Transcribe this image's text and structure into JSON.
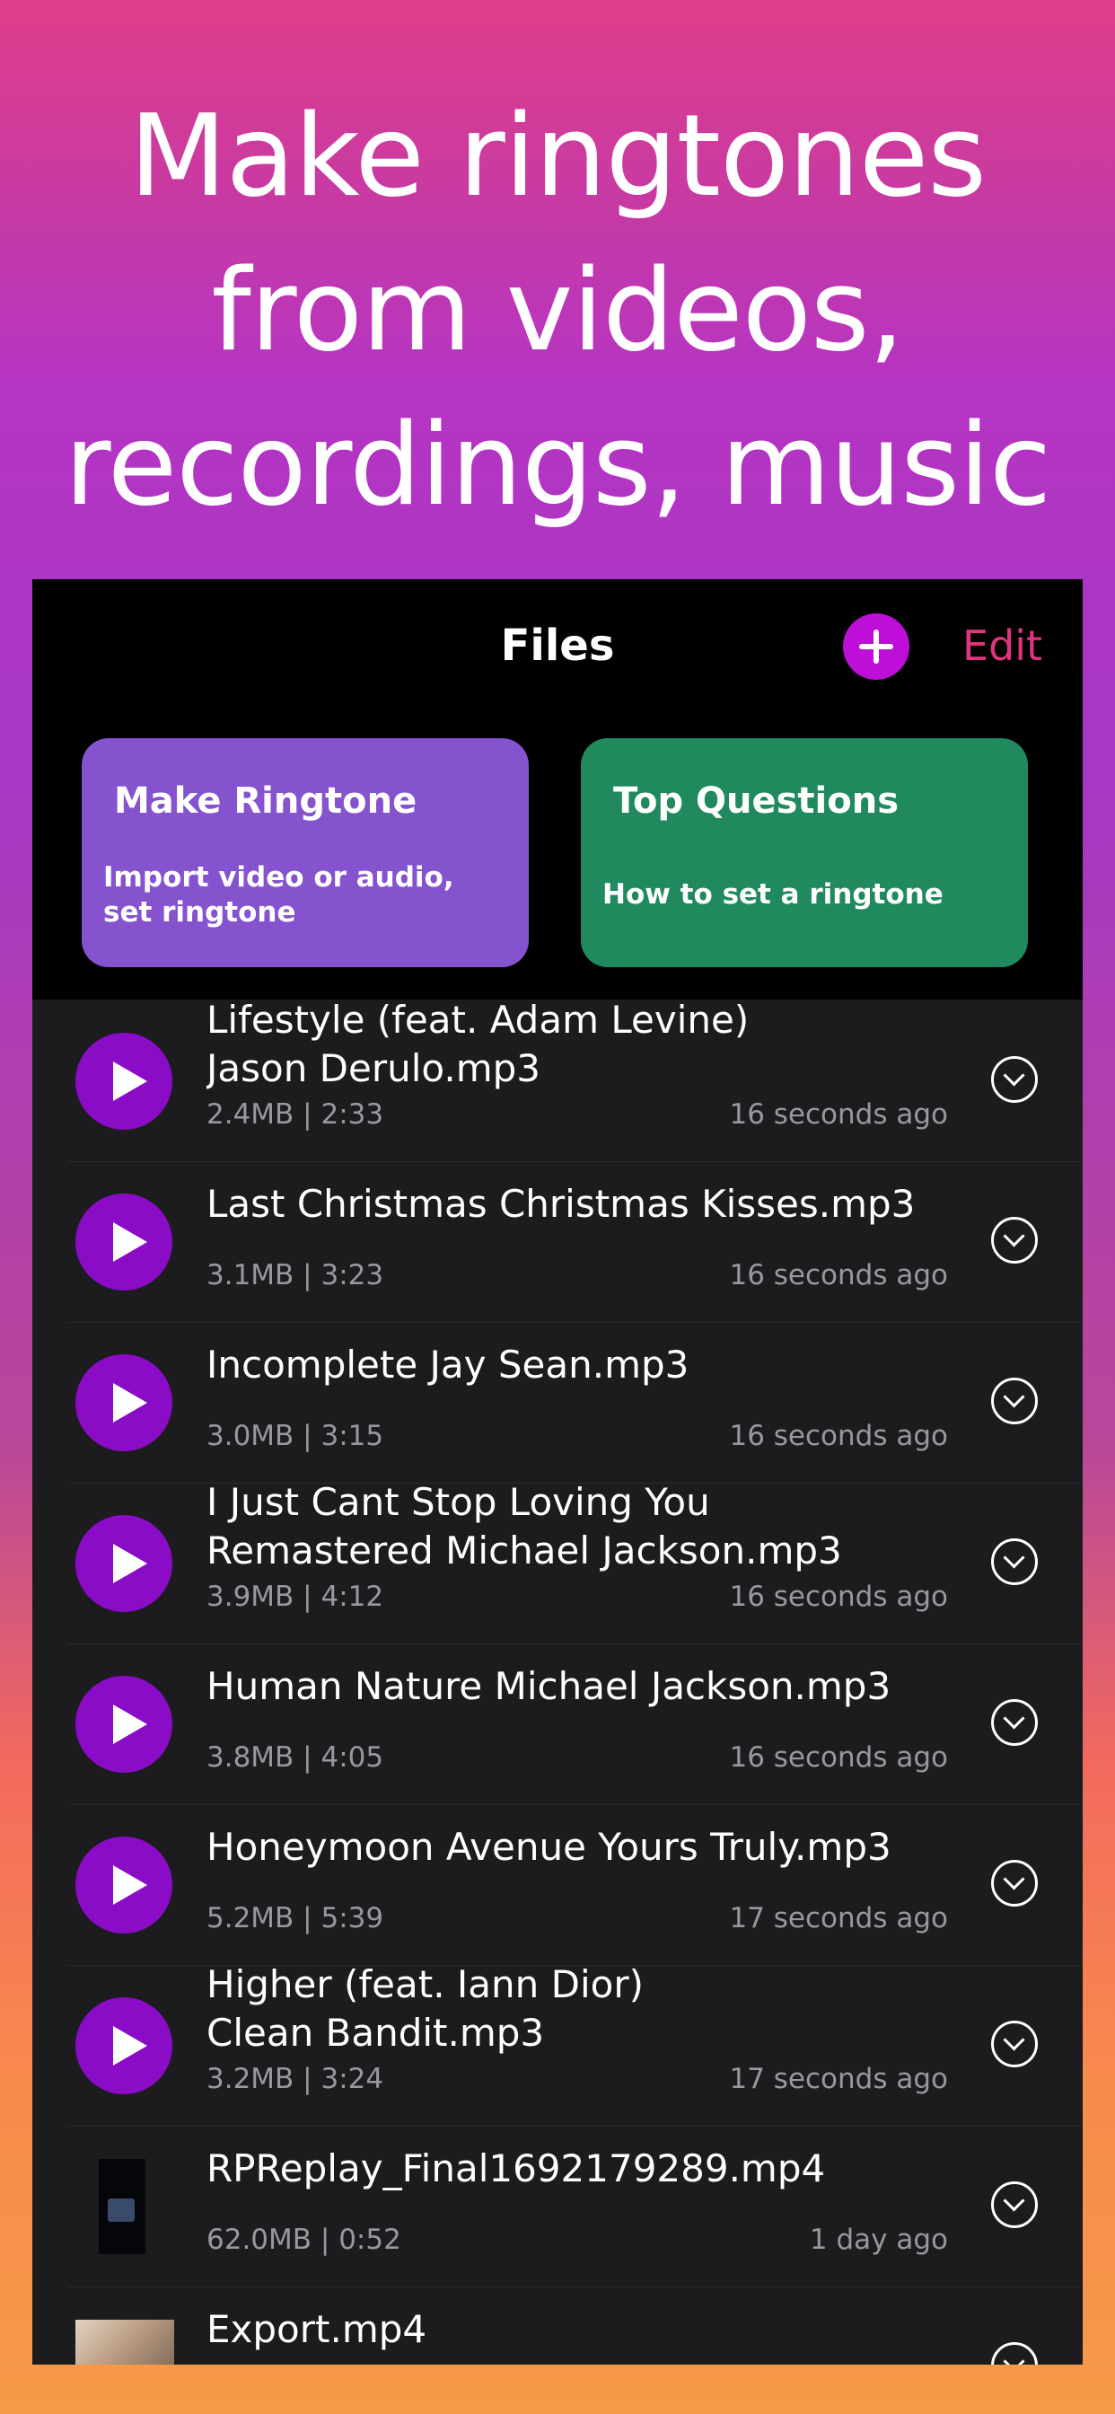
{
  "headline": {
    "line1": "Make ringtones",
    "line2": "from videos,",
    "line3": "recordings, music"
  },
  "header": {
    "title": "Files",
    "add_icon": "plus-circle-icon",
    "edit_label": "Edit"
  },
  "cards": {
    "make": {
      "title": "Make Ringtone",
      "subtitle": "Import video or audio, set ringtone"
    },
    "faq": {
      "title": "Top Questions",
      "subtitle": "How to set a ringtone"
    }
  },
  "files": [
    {
      "line1": "Lifestyle (feat. Adam Levine)",
      "line2": "Jason Derulo.mp3",
      "meta": "2.4MB | 2:33",
      "time": "16 seconds ago",
      "icon": "play-icon"
    },
    {
      "line1": "Last Christmas Christmas Kisses.mp3",
      "line2": "",
      "meta": "3.1MB | 3:23",
      "time": "16 seconds ago",
      "icon": "play-icon"
    },
    {
      "line1": "Incomplete Jay Sean.mp3",
      "line2": "",
      "meta": "3.0MB | 3:15",
      "time": "16 seconds ago",
      "icon": "play-icon"
    },
    {
      "line1": "I Just Cant Stop Loving You",
      "line2": "Remastered Michael Jackson.mp3",
      "meta": "3.9MB | 4:12",
      "time": "16 seconds ago",
      "icon": "play-icon"
    },
    {
      "line1": "Human Nature Michael Jackson.mp3",
      "line2": "",
      "meta": "3.8MB | 4:05",
      "time": "16 seconds ago",
      "icon": "play-icon"
    },
    {
      "line1": "Honeymoon Avenue Yours Truly.mp3",
      "line2": "",
      "meta": "5.2MB | 5:39",
      "time": "17 seconds ago",
      "icon": "play-icon"
    },
    {
      "line1": "Higher (feat. Iann Dior)",
      "line2": "Clean Bandit.mp3",
      "meta": "3.2MB | 3:24",
      "time": "17 seconds ago",
      "icon": "play-icon"
    },
    {
      "line1": "RPReplay_Final1692179289.mp4",
      "line2": "",
      "meta": "62.0MB | 0:52",
      "time": "1 day ago",
      "icon": "video-thumbnail"
    },
    {
      "line1": "Export.mp4",
      "line2": "",
      "meta": "",
      "time": "",
      "icon": "video-thumbnail"
    }
  ],
  "colors": {
    "accent_purple": "#8a0cc6",
    "add_button": "#bd0fd8",
    "edit_pink": "#e0347e",
    "card_purple": "#8653cf",
    "card_green": "#208a5e"
  }
}
